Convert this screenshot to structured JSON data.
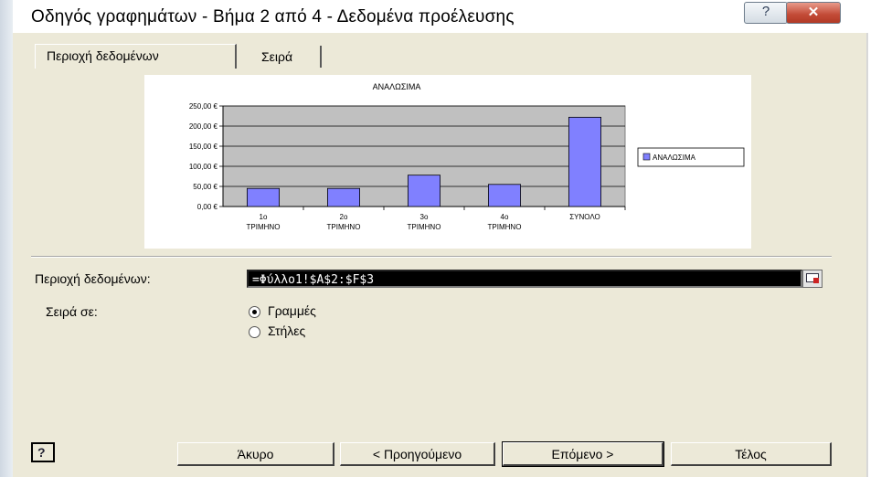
{
  "window": {
    "title": "Οδηγός γραφημάτων - Βήμα 2 από 4 - Δεδομένα προέλευσης",
    "help_glyph": "?",
    "close_glyph": "✕"
  },
  "tabs": [
    {
      "label": "Περιοχή δεδομένων",
      "selected": true
    },
    {
      "label": "Σειρά",
      "selected": false
    }
  ],
  "chart_data": {
    "type": "bar",
    "title": "ΑΝΑΛΩΣΙΜΑ",
    "categories": [
      [
        "1ο",
        "ΤΡΙΜΗΝΟ"
      ],
      [
        "2ο",
        "ΤΡΙΜΗΝΟ"
      ],
      [
        "3ο",
        "ΤΡΙΜΗΝΟ"
      ],
      [
        "4ο",
        "ΤΡΙΜΗΝΟ"
      ],
      [
        "ΣΥΝΟΛΟ"
      ]
    ],
    "series": [
      {
        "name": "ΑΝΑΛΩΣΙΜΑ",
        "values": [
          45,
          45,
          78,
          55,
          222
        ],
        "color": "#8080ff"
      }
    ],
    "ylim": [
      0,
      250
    ],
    "yticks": [
      0,
      50,
      100,
      150,
      200,
      250
    ],
    "ytick_labels": [
      "0,00 €",
      "50,00 €",
      "100,00 €",
      "150,00 €",
      "200,00 €",
      "250,00 €"
    ],
    "grid": true,
    "plot_background": "#c0c0c0",
    "legend": "right"
  },
  "form": {
    "range_label": "Περιοχή δεδομένων:",
    "range_value": "=Φύλλο1!$A$2:$F$3",
    "series_in_label": "Σειρά σε:",
    "option_rows": "Γραμμές",
    "option_cols": "Στήλες",
    "selected_option": "rows"
  },
  "buttons": {
    "help": "?",
    "cancel": "Άκυρο",
    "back": "< Προηγούμενο",
    "next": "Επόμενο >",
    "finish": "Τέλος"
  }
}
